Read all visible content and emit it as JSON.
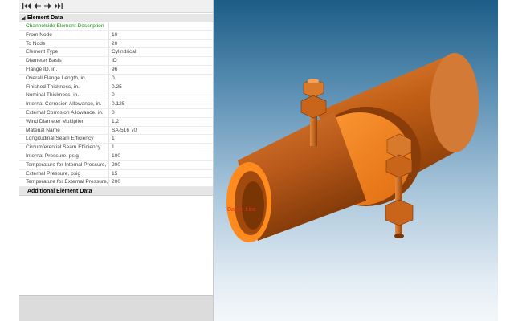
{
  "toolbar": {
    "buttons": [
      {
        "name": "first-element-icon"
      },
      {
        "name": "previous-element-icon"
      },
      {
        "name": "next-element-icon"
      },
      {
        "name": "last-element-icon"
      }
    ]
  },
  "element_data": {
    "header": "Element Data",
    "title_row": "Channelside Element Description",
    "rows": [
      {
        "label": "From Node",
        "value": "10"
      },
      {
        "label": "To Node",
        "value": "20"
      },
      {
        "label": "Element Type",
        "value": "Cylindrical"
      },
      {
        "label": "Diameter Basis",
        "value": "ID"
      },
      {
        "label": "Flange ID, in.",
        "value": "96"
      },
      {
        "label": "Overall Flange Length, in.",
        "value": "0"
      },
      {
        "label": "Finished Thickness, in.",
        "value": "0.25"
      },
      {
        "label": "Nominal Thickness, in.",
        "value": "0"
      },
      {
        "label": "Internal Corrosion Allowance, in.",
        "value": "0.125"
      },
      {
        "label": "External Corrosion Allowance, in.",
        "value": "0"
      },
      {
        "label": "Wind Diameter Multiplier",
        "value": "1.2"
      },
      {
        "label": "Material Name",
        "value": "SA-516 70"
      },
      {
        "label": "Longitudinal Seam Efficiency",
        "value": "1"
      },
      {
        "label": "Circumferential Seam Efficiency",
        "value": "1"
      },
      {
        "label": "Internal Pressure, psig",
        "value": "100"
      },
      {
        "label": "Temperature for Internal Pressure, F",
        "value": "200"
      },
      {
        "label": "External Pressure, psig",
        "value": "15"
      },
      {
        "label": "Temperature for External Pressure, F",
        "value": "200"
      }
    ]
  },
  "additional_header": "Additional Element Data",
  "viewport": {
    "label": "Datum Line",
    "colors": {
      "body": "#c8651a",
      "highlight": "#f7a35a",
      "shadow": "#7a3505",
      "bright": "#ff8a1e"
    }
  }
}
